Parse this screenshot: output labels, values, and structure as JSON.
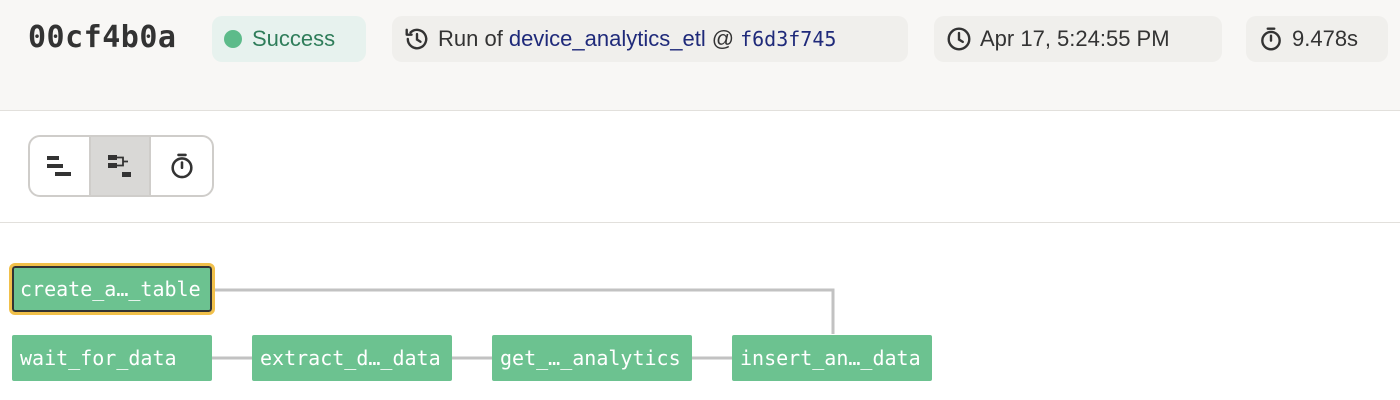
{
  "header": {
    "run_id": "00cf4b0a",
    "status": "Success",
    "run_of_prefix": "Run of",
    "job_name": "device_analytics_etl",
    "at_symbol": "@",
    "snapshot_id": "f6d3f745",
    "timestamp": "Apr 17, 5:24:55 PM",
    "duration": "9.478s"
  },
  "toolbar": {
    "view_modes": [
      {
        "icon": "waterfall-icon",
        "active": false
      },
      {
        "icon": "tree-graph-icon",
        "active": true
      },
      {
        "icon": "stopwatch-icon",
        "active": false
      }
    ]
  },
  "graph": {
    "nodes": [
      {
        "label": "create_a…_table",
        "selected": true
      },
      {
        "label": "wait_for_data",
        "selected": false
      },
      {
        "label": "extract_d…_data",
        "selected": false
      },
      {
        "label": "get_…_analytics",
        "selected": false
      },
      {
        "label": "insert_an…_data",
        "selected": false
      }
    ]
  },
  "colors": {
    "success_node": "#6cc290",
    "selected_outline": "#f1c04a",
    "status_text": "#2f7d5a",
    "link_text": "#1f2a7a"
  }
}
